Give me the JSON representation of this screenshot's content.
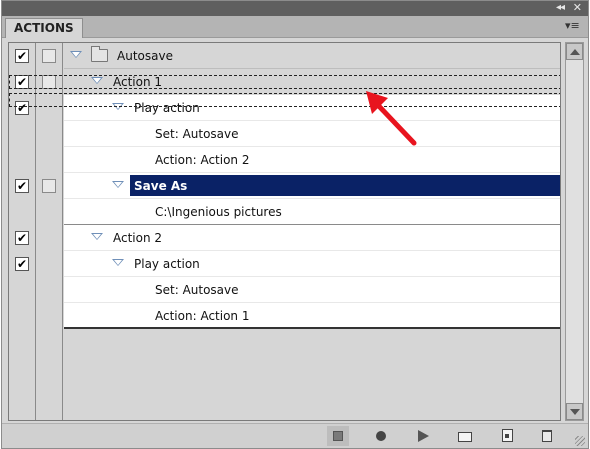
{
  "panel": {
    "tab_title": "ACTIONS",
    "collapse_glyph": "◂◂",
    "close_glyph": "✕",
    "menu_glyph": "▾≡"
  },
  "actions": [
    {
      "label": "Autosave",
      "type": "set",
      "checked": true,
      "dialog": true,
      "expanded": true
    },
    {
      "label": "Action 1",
      "type": "action",
      "checked": true,
      "dialog": true,
      "expanded": true
    },
    {
      "label": "Play action",
      "type": "command",
      "checked": true,
      "dialog": false,
      "expanded": true
    },
    {
      "label": "Set: Autosave",
      "type": "param"
    },
    {
      "label": "Action: Action 2",
      "type": "param"
    },
    {
      "label": "Save As",
      "type": "command",
      "checked": true,
      "dialog": true,
      "expanded": true,
      "selected": true
    },
    {
      "label": "C:\\Ingenious pictures",
      "type": "param"
    },
    {
      "label": "Action 2",
      "type": "action",
      "checked": true,
      "dialog": false,
      "expanded": true
    },
    {
      "label": "Play action",
      "type": "command",
      "checked": true,
      "dialog": false,
      "expanded": true
    },
    {
      "label": "Set: Autosave",
      "type": "param"
    },
    {
      "label": "Action: Action 1",
      "type": "param"
    }
  ],
  "check_glyph": "✔",
  "toolbar": {
    "buttons": [
      "stop-icon",
      "record-icon",
      "play-icon",
      "new-set-icon",
      "new-action-icon",
      "trash-icon"
    ]
  },
  "colors": {
    "selection": "#0a2266",
    "annotation_arrow": "#e8141e",
    "panel_bg": "#d6d6d6"
  }
}
